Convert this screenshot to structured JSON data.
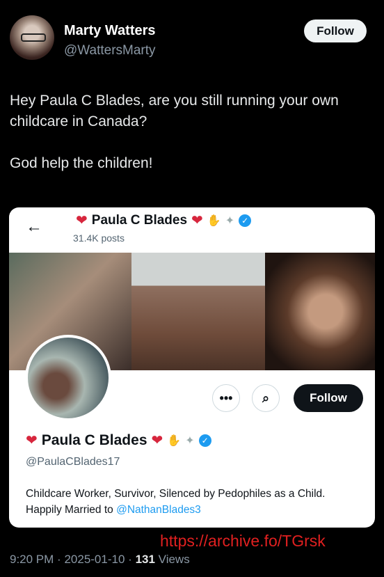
{
  "author": {
    "name": "Marty Watters",
    "handle": "@WattersMarty",
    "follow_label": "Follow"
  },
  "tweet": {
    "text": "Hey Paula C Blades, are you still running your own childcare in Canada?\n\nGod help the children!"
  },
  "card": {
    "back_glyph": "←",
    "header_name": "Paula C Blades",
    "posts": "31.4K posts",
    "more_glyph": "•••",
    "search_glyph": "⌕",
    "follow_label": "Follow",
    "profile_name": "Paula C Blades",
    "profile_handle": "@PaulaCBlades17",
    "bio_text": "Childcare Worker, Survivor, Silenced by Pedophiles as a Child.  Happily Married to ",
    "bio_mention": "@NathanBlades3",
    "colors": {
      "heart": "#d7263d",
      "verified": "#1d9bf0",
      "mention": "#1d9bf0"
    }
  },
  "archive_link": "https://archive.fo/TGrsk",
  "meta": {
    "time": "9:20 PM",
    "date": "2025-01-10",
    "views_count": "131",
    "views_label": "Views",
    "sep": "·"
  },
  "icons": [
    "heart-icon",
    "praying-hands-icon",
    "dove-icon",
    "verified-badge-icon",
    "back-arrow-icon",
    "search-icon",
    "more-icon"
  ]
}
